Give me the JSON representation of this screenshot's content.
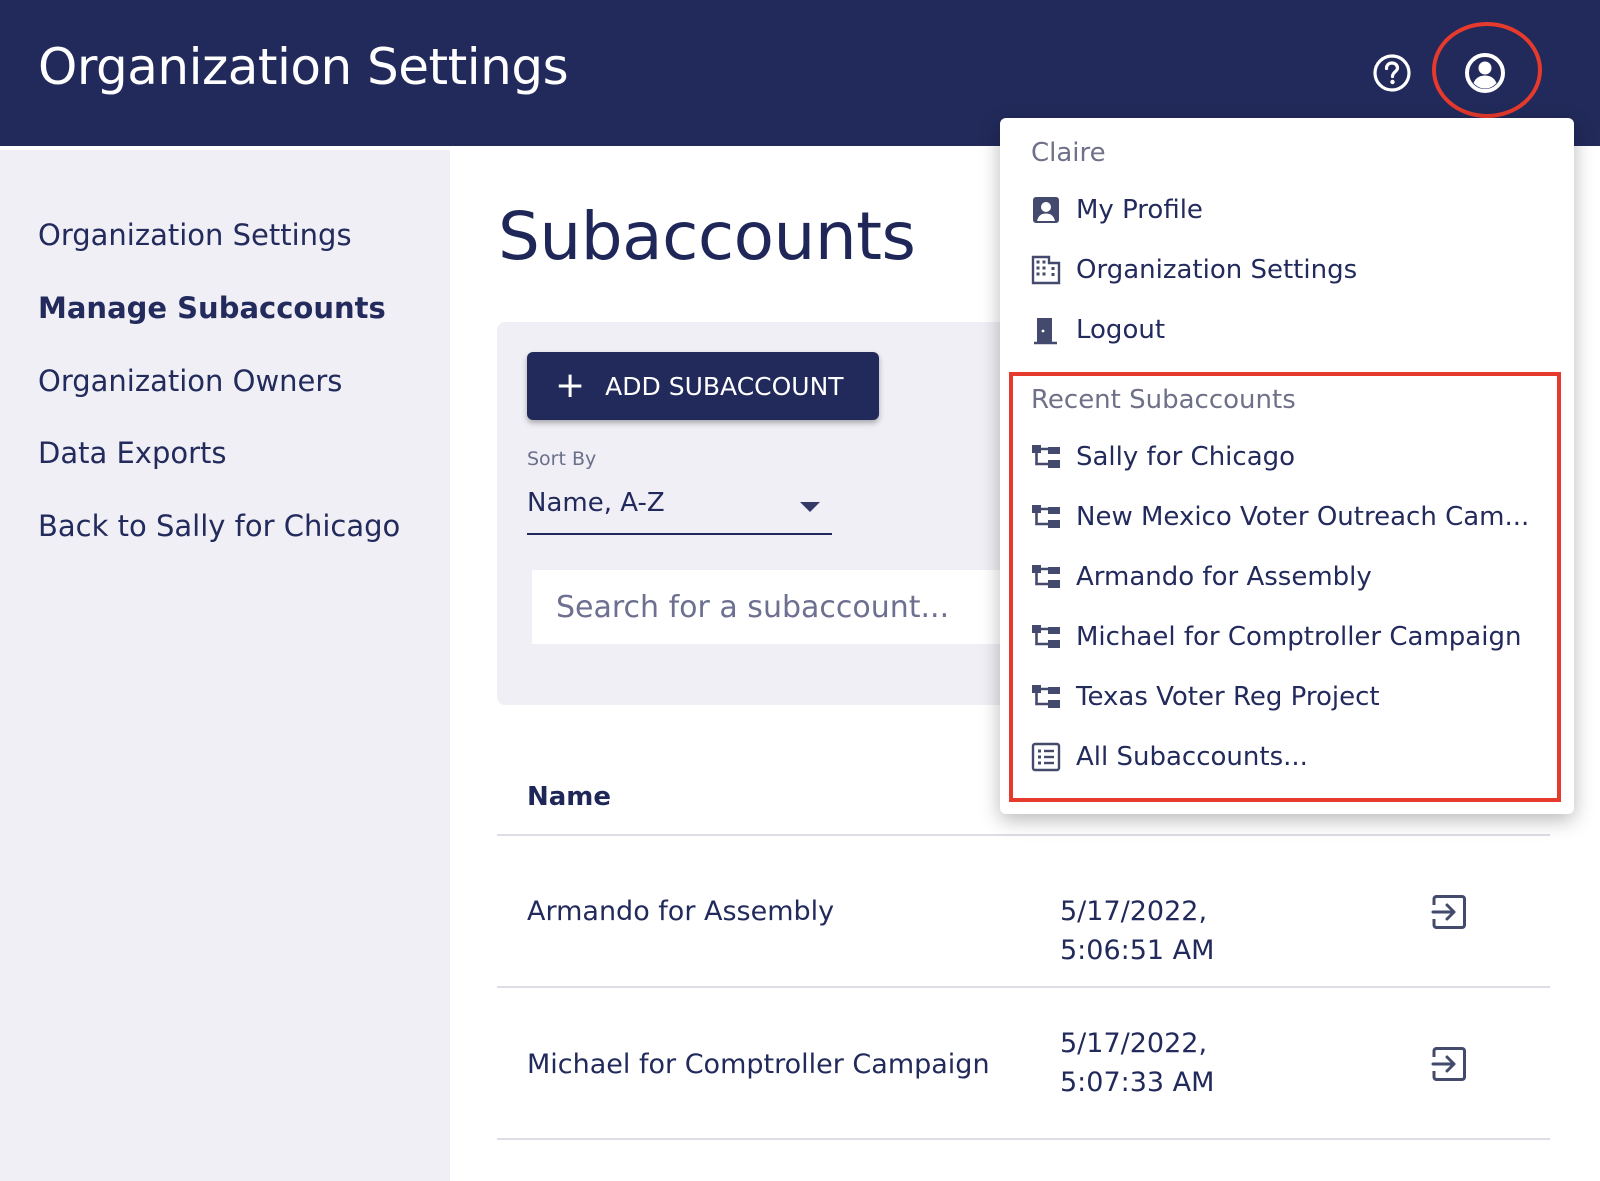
{
  "header": {
    "title": "Organization Settings",
    "help_icon": "help-circle-icon",
    "account_icon": "account-circle-icon"
  },
  "sidebar": {
    "items": [
      {
        "label": "Organization Settings",
        "active": false
      },
      {
        "label": "Manage Subaccounts",
        "active": true
      },
      {
        "label": "Organization Owners",
        "active": false
      },
      {
        "label": "Data Exports",
        "active": false
      },
      {
        "label": "Back to Sally for Chicago",
        "active": false
      }
    ]
  },
  "main": {
    "title": "Subaccounts",
    "add_button_label": "ADD SUBACCOUNT",
    "sort": {
      "label": "Sort By",
      "value": "Name, A-Z"
    },
    "search": {
      "placeholder": "Search for a subaccount..."
    },
    "table": {
      "columns": [
        "Name"
      ],
      "rows": [
        {
          "name": "Armando for Assembly",
          "date": "5/17/2022, 5:06:51 AM"
        },
        {
          "name": "Michael for Comptroller Campaign",
          "date": "5/17/2022, 5:07:33 AM"
        }
      ]
    }
  },
  "account_menu": {
    "user_name": "Claire",
    "items": [
      {
        "label": "My Profile",
        "icon": "account-box-icon"
      },
      {
        "label": "Organization Settings",
        "icon": "office-building-icon"
      },
      {
        "label": "Logout",
        "icon": "exit-door-icon"
      }
    ],
    "recent_heading": "Recent Subaccounts",
    "recent": [
      {
        "label": "Sally for Chicago",
        "icon": "file-tree-icon"
      },
      {
        "label": "New Mexico Voter Outreach Cam...",
        "icon": "file-tree-icon"
      },
      {
        "label": "Armando for Assembly",
        "icon": "file-tree-icon"
      },
      {
        "label": "Michael for Comptroller Campaign",
        "icon": "file-tree-icon"
      },
      {
        "label": "Texas Voter Reg Project",
        "icon": "file-tree-icon"
      }
    ],
    "all_label": "All Subaccounts...",
    "all_icon": "list-box-icon"
  },
  "colors": {
    "brand_navy": "#222a5b",
    "sidebar_bg": "#efeff5",
    "annotation_red": "#e53a2c"
  }
}
